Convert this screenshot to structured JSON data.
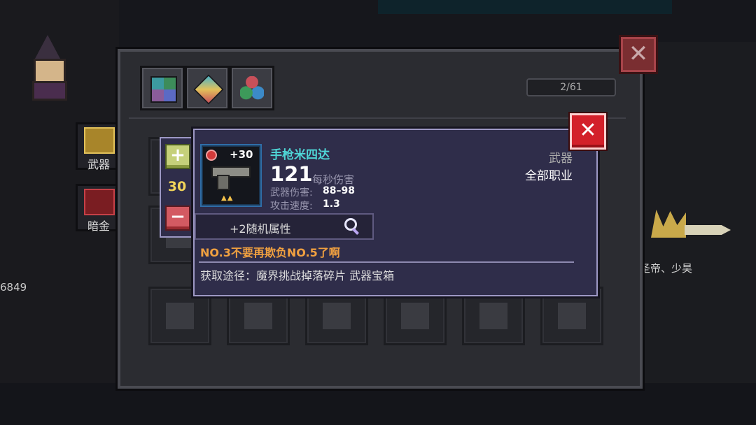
{
  "background": {
    "score": "6849",
    "hero_name": "圣帝、少昊"
  },
  "side_tabs": [
    {
      "label": "武器"
    },
    {
      "label": "暗金"
    }
  ],
  "inventory": {
    "page_counter": "2/61",
    "category_tabs": [
      "all-categories-icon",
      "gem-icon",
      "triple-orb-icon"
    ]
  },
  "popup": {
    "quantity": {
      "value": "30",
      "plus_icon": "+",
      "minus_icon": "−"
    },
    "item": {
      "level": "+30",
      "stars": "▲▲",
      "name": "手枪米四达",
      "dps_value": "121",
      "dps_label": "每秒伤害",
      "damage_label": "武器伤害:",
      "damage_value": "88–98",
      "speed_label": "攻击速度:",
      "speed_value": "1.3",
      "type": "武器",
      "class": "全部职业"
    },
    "random_attribute": "+2随机属性",
    "flavor_text": "NO.3不要再欺负NO.5了啊",
    "source_text": "获取途径：魔界挑战掉落碎片 武器宝箱",
    "close_icon": "✕"
  },
  "panel_close_icon": "✕",
  "colors": {
    "item_name": "#4fd6d6",
    "flavor": "#f0a040",
    "quantity": "#f2d45a",
    "close_red": "#d3202a"
  }
}
